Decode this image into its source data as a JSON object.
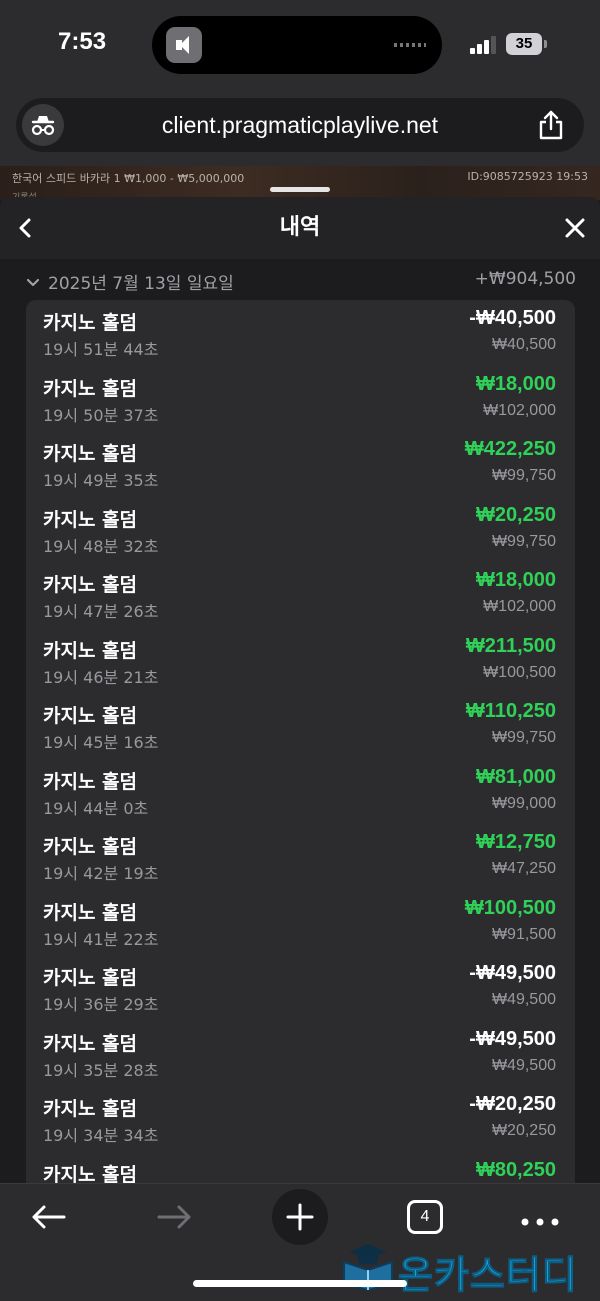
{
  "status_bar": {
    "time": "7:53",
    "battery": "35"
  },
  "browser": {
    "url": "client.pragmaticplaylive.net"
  },
  "game_header": {
    "title": "한국어 스피드 바카라 1  ₩1,000 - ₩5,000,000",
    "id_time": "ID:9085725923  19:53",
    "subtitle": "기록설"
  },
  "sheet": {
    "title": "내역",
    "date_label": "2025년 7월 13일 일요일",
    "date_total": "+₩904,500"
  },
  "transactions": [
    {
      "name": "카지노 홀덤",
      "time": "19시 51분 44초",
      "amount": "-₩40,500",
      "balance": "₩40,500",
      "type": "loss"
    },
    {
      "name": "카지노 홀덤",
      "time": "19시 50분 37초",
      "amount": "₩18,000",
      "balance": "₩102,000",
      "type": "win"
    },
    {
      "name": "카지노 홀덤",
      "time": "19시 49분 35초",
      "amount": "₩422,250",
      "balance": "₩99,750",
      "type": "win"
    },
    {
      "name": "카지노 홀덤",
      "time": "19시 48분 32초",
      "amount": "₩20,250",
      "balance": "₩99,750",
      "type": "win"
    },
    {
      "name": "카지노 홀덤",
      "time": "19시 47분 26초",
      "amount": "₩18,000",
      "balance": "₩102,000",
      "type": "win"
    },
    {
      "name": "카지노 홀덤",
      "time": "19시 46분 21초",
      "amount": "₩211,500",
      "balance": "₩100,500",
      "type": "win"
    },
    {
      "name": "카지노 홀덤",
      "time": "19시 45분 16초",
      "amount": "₩110,250",
      "balance": "₩99,750",
      "type": "win"
    },
    {
      "name": "카지노 홀덤",
      "time": "19시 44분 0초",
      "amount": "₩81,000",
      "balance": "₩99,000",
      "type": "win"
    },
    {
      "name": "카지노 홀덤",
      "time": "19시 42분 19초",
      "amount": "₩12,750",
      "balance": "₩47,250",
      "type": "win"
    },
    {
      "name": "카지노 홀덤",
      "time": "19시 41분 22초",
      "amount": "₩100,500",
      "balance": "₩91,500",
      "type": "win"
    },
    {
      "name": "카지노 홀덤",
      "time": "19시 36분 29초",
      "amount": "-₩49,500",
      "balance": "₩49,500",
      "type": "loss"
    },
    {
      "name": "카지노 홀덤",
      "time": "19시 35분 28초",
      "amount": "-₩49,500",
      "balance": "₩49,500",
      "type": "loss"
    },
    {
      "name": "카지노 홀덤",
      "time": "19시 34분 34초",
      "amount": "-₩20,250",
      "balance": "₩20,250",
      "type": "loss"
    },
    {
      "name": "카지노 홀덤",
      "time": "",
      "amount": "₩80,250",
      "balance": "",
      "type": "win"
    }
  ],
  "toolbar": {
    "tab_count": "4"
  },
  "watermark": {
    "text": "온카스터디"
  },
  "colors": {
    "win": "#30d158",
    "loss": "#ffffff",
    "background": "#1c1c1e"
  }
}
